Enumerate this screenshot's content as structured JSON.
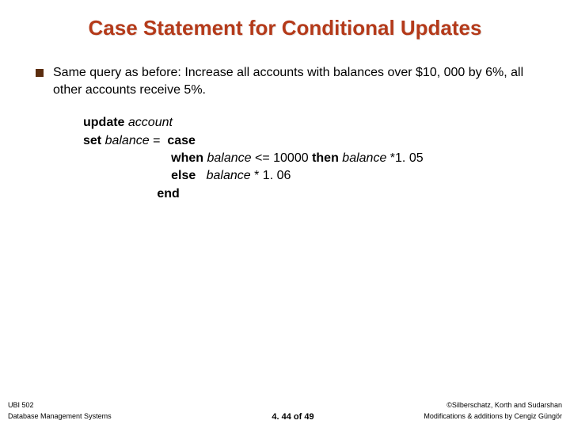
{
  "title": "Case Statement for Conditional Updates",
  "bullet": "Same query as before: Increase all accounts with balances over $10, 000 by 6%, all other accounts receive 5%.",
  "code": {
    "l1": {
      "a": "update",
      "b": "account"
    },
    "l2": {
      "a": "set",
      "b": "balance",
      "c": "=",
      "d": "case"
    },
    "l3": {
      "a": "when",
      "b": "balance",
      "c": "<= 10000",
      "d": "then",
      "e": "balance",
      "f": "*1. 05"
    },
    "l4": {
      "a": "else",
      "b": "balance",
      "c": "* 1. 06"
    },
    "l5": {
      "a": "end"
    }
  },
  "footer": {
    "course": "UBI 502",
    "subtitle": "Database Management Systems",
    "page": "4. 44 of 49",
    "copyright": "©Silberschatz, Korth and Sudarshan",
    "credits": "Modifications & additions by Cengiz Güngör"
  }
}
